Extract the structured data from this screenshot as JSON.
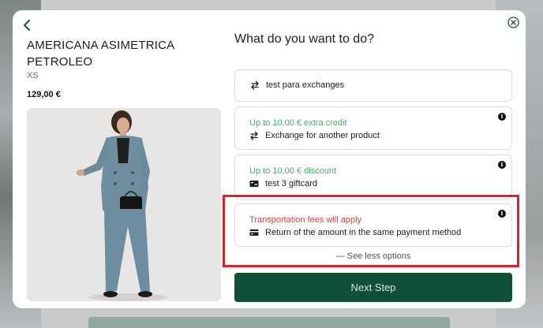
{
  "product": {
    "title": "AMERICANA ASIMETRICA PETROLEO",
    "size": "XS",
    "price": "129,00 €"
  },
  "question": "What do you want to do?",
  "options": [
    {
      "label": "test para exchanges",
      "icon": "exchange-arrows-icon"
    },
    {
      "promo": "Up to 10,00 € extra credit",
      "label": "Exchange for another product",
      "icon": "exchange-arrows-icon",
      "info": "i"
    },
    {
      "promo": "Up to 10,00 € discount",
      "label": "test 3 giftcard",
      "icon": "giftcard-icon",
      "info": "i"
    },
    {
      "warning": "Transportation fees will apply",
      "label": "Return of the amount in the same payment method",
      "icon": "credit-card-icon",
      "info": "i"
    }
  ],
  "see_less": "— See less options",
  "next_button": "Next Step",
  "colors": {
    "primary": "#0f5038",
    "promo_green": "#3fb36b",
    "warning_red": "#e0403c",
    "highlight": "#e0202a"
  }
}
